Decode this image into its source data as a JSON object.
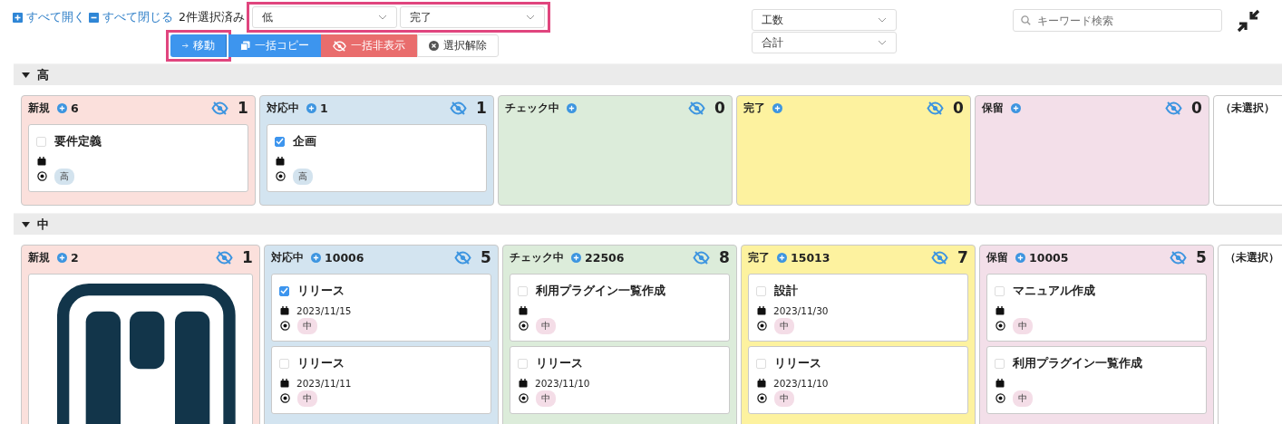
{
  "toolbar": {
    "expand_all": "すべて開く",
    "collapse_all": "すべて閉じる",
    "selection_count": "2件選択済み",
    "filters": [
      {
        "value": "低"
      },
      {
        "value": "完了"
      }
    ],
    "actions": [
      {
        "label": "移動",
        "kind": "move"
      },
      {
        "label": "一括コピー",
        "kind": "copy"
      },
      {
        "label": "一括非表示",
        "kind": "hide"
      },
      {
        "label": "選択解除",
        "kind": "clear"
      }
    ],
    "aggregates": [
      {
        "value": "工数"
      },
      {
        "value": "合計"
      }
    ],
    "search": {
      "placeholder": "キーワード検索"
    }
  },
  "sections": [
    {
      "title": "高",
      "expanded": true,
      "columns": [
        {
          "name": "新規",
          "color": "#fbe0dc",
          "sum": "6",
          "hidden_count": "1",
          "cards": [
            {
              "kind": "task",
              "title": "要件定義",
              "checked": false,
              "priority": {
                "label": "高",
                "color": "#d3e3ee"
              }
            }
          ]
        },
        {
          "name": "対応中",
          "color": "#d3e4f0",
          "sum": "1",
          "hidden_count": "1",
          "cards": [
            {
              "kind": "task",
              "title": "企画",
              "checked": true,
              "priority": {
                "label": "高",
                "color": "#d3e3ee"
              }
            }
          ]
        },
        {
          "name": "チェック中",
          "color": "#dcecda",
          "hidden_count": "0"
        },
        {
          "name": "完了",
          "color": "#fdf29f",
          "hidden_count": "0"
        },
        {
          "name": "保留",
          "color": "#f3dfe9",
          "hidden_count": "0"
        },
        {
          "name": "（未選択）",
          "color": "#ffffff"
        }
      ]
    },
    {
      "title": "中",
      "expanded": true,
      "columns": [
        {
          "name": "新規",
          "color": "#fbe0dc",
          "sum": "2",
          "hidden_count": "1",
          "cards": [
            {
              "kind": "image"
            }
          ]
        },
        {
          "name": "対応中",
          "color": "#d3e4f0",
          "sum": "10006",
          "hidden_count": "5",
          "cards": [
            {
              "kind": "task",
              "title": "リリース",
              "checked": true,
              "date": "2023/11/15",
              "priority": {
                "label": "中",
                "color": "#f4dde7"
              }
            },
            {
              "kind": "task",
              "title": "リリース",
              "checked": false,
              "date": "2023/11/11",
              "priority": {
                "label": "中",
                "color": "#f4dde7"
              }
            }
          ]
        },
        {
          "name": "チェック中",
          "color": "#dcecda",
          "sum": "22506",
          "hidden_count": "8",
          "cards": [
            {
              "kind": "task",
              "title": "利用プラグイン一覧作成",
              "checked": false,
              "priority": {
                "label": "中",
                "color": "#f4dde7"
              }
            },
            {
              "kind": "task",
              "title": "リリース",
              "checked": false,
              "date": "2023/11/10",
              "priority": {
                "label": "中",
                "color": "#f4dde7"
              }
            }
          ]
        },
        {
          "name": "完了",
          "color": "#fdf29f",
          "sum": "15013",
          "hidden_count": "7",
          "cards": [
            {
              "kind": "task",
              "title": "設計",
              "checked": false,
              "date": "2023/11/30",
              "priority": {
                "label": "中",
                "color": "#f4dde7"
              }
            },
            {
              "kind": "task",
              "title": "リリース",
              "checked": false,
              "date": "2023/11/10",
              "priority": {
                "label": "中",
                "color": "#f4dde7"
              }
            }
          ]
        },
        {
          "name": "保留",
          "color": "#f3dfe9",
          "sum": "10005",
          "hidden_count": "5",
          "cards": [
            {
              "kind": "task",
              "title": "マニュアル作成",
              "checked": false,
              "priority": {
                "label": "中",
                "color": "#f4dde7"
              }
            },
            {
              "kind": "task",
              "title": "利用プラグイン一覧作成",
              "checked": false,
              "priority": {
                "label": "中",
                "color": "#f4dde7"
              }
            }
          ]
        },
        {
          "name": "（未選択）",
          "color": "#ffffff"
        }
      ]
    }
  ]
}
